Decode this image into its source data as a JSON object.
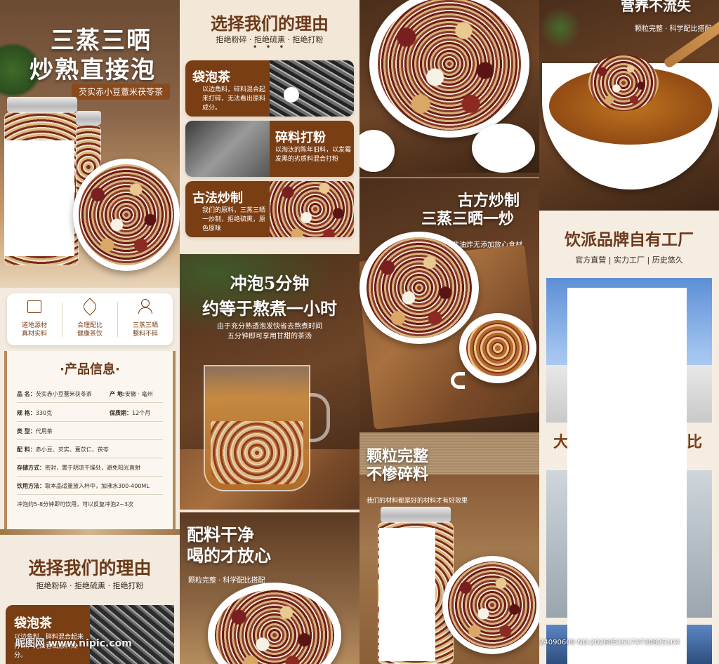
{
  "col1": {
    "hero_title_line1": "三蒸三晒",
    "hero_title_line2": "炒熟直接泡",
    "hero_tag": "芡实赤小豆薏米茯苓茶",
    "features": [
      {
        "icon": "book-icon",
        "line1": "道地源材",
        "line2": "真材实料"
      },
      {
        "icon": "leaf-icon",
        "line1": "合理配比",
        "line2": "健康茶饮"
      },
      {
        "icon": "person-icon",
        "line1": "三蒸三晒",
        "line2": "整料不碎"
      }
    ],
    "info_title": "·产品信息·",
    "info": {
      "name_label": "品 名：",
      "name_value": "芡实赤小豆薏米茯苓茶",
      "origin_label": "产 地:",
      "origin_value": "安徽 · 亳州",
      "spec_label": "规 格：",
      "spec_value": "330克",
      "shelf_label": "保质期：",
      "shelf_value": "12个月",
      "type_label": "类 型：",
      "type_value": "代用茶",
      "ingredients_label": "配 料：",
      "ingredients_value": "赤小豆、芡实、薏苡仁、茯苓",
      "storage_label": "存储方式：",
      "storage_value": "密封，置于阴凉干燥处，避免阳光直射",
      "drink_label": "饮用方法：",
      "drink_value": "取本品适量放入杯中，加沸水300-400ML",
      "drink_cont": "冲泡约5-8分钟即可饮用，可以反复冲泡2~3次"
    },
    "reason_title": "选择我们的理由",
    "reason_sub": "拒绝粉碎 · 拒绝硫熏 · 拒绝打粉",
    "bag_title": "袋泡茶",
    "bag_text": "以边角料，碎料混合起来打碎，无法看出原料成分。",
    "watermark": "昵图网 www.nipic.com"
  },
  "col2": {
    "reason_title": "选择我们的理由",
    "reason_sub": "拒绝粉碎 · 拒绝硫熏 · 拒绝打粉",
    "dots": "• • •",
    "items": [
      {
        "title": "袋泡茶",
        "text": "以边角料，碎料混合起来打碎，无法看出原料成分。"
      },
      {
        "title": "碎料打粉",
        "text": "以淘汰的陈年旧料，以发霉发黑的劣质料混合打粉"
      },
      {
        "title": "古法炒制",
        "text": "我们的原料，三蒸三晒一炒制，拒绝硫熏，原色原味"
      }
    ],
    "brew_title1": "冲泡5分钟",
    "brew_title2": "约等于熬煮一小时",
    "brew_sub1": "由于充分熟透泡发快省去熬煮时间",
    "brew_sub2": "五分钟即可享用甘甜的茶汤",
    "clean_title1": "配料干净",
    "clean_title2": "喝的才放心",
    "clean_sub": "颗粒完整 · 科学配比搭配"
  },
  "col3": {
    "ancient_title1": "古方炒制",
    "ancient_title2": "三蒸三晒一炒",
    "ancient_sub": "非油炸无添加放心食材",
    "grain_title1": "颗粒完整",
    "grain_title2": "不惨碎料",
    "grain_sub": "我们的材料都是好的材料才有好效果"
  },
  "col4": {
    "top_title": "营养不流失",
    "top_sub": "颗粒完整 · 科学配比搭配",
    "brand_title": "饮派品牌自有工厂",
    "brand_sub": "官方直营 | 实力工厂 | 历史悠久",
    "big_left": "大",
    "big_right": "比",
    "id_text": "ID:24090609 NO:20260515174730825104"
  },
  "colors": {
    "accent_brown": "#7a3e14",
    "cream": "#f3ebe0",
    "dark_wood": "#4a2e1b"
  }
}
